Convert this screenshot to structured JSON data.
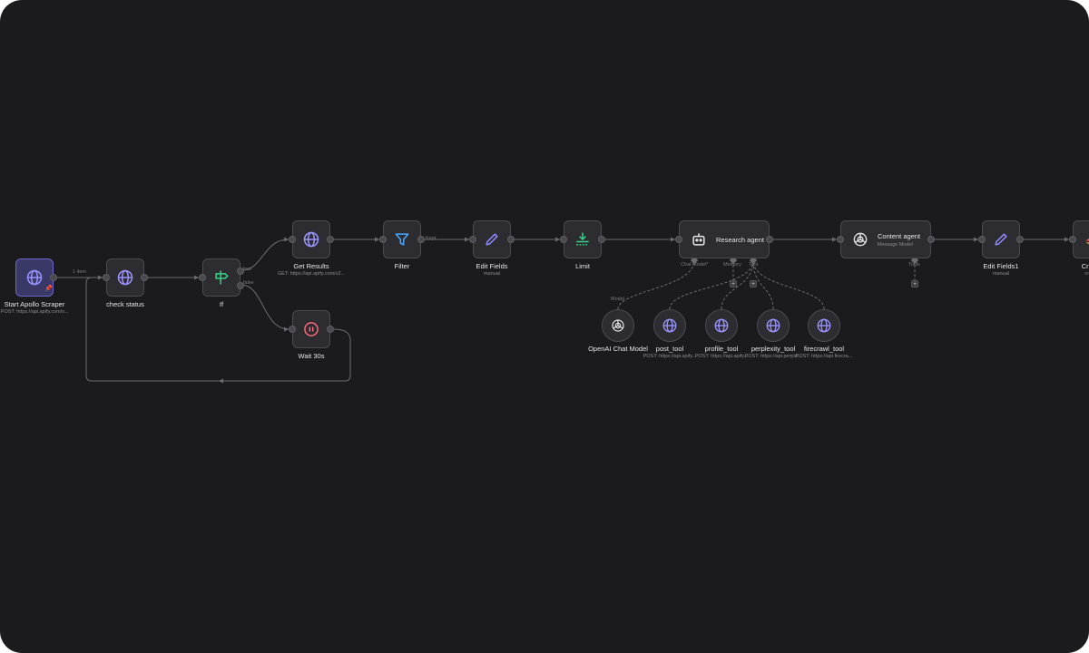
{
  "workflow": {
    "nodes": {
      "start_apollo_scraper": {
        "label": "Start Apollo Scraper",
        "sub": "POST: https://api.apify.com/v...",
        "icon": "globe-icon"
      },
      "check_status": {
        "label": "check status",
        "icon": "globe-icon"
      },
      "if": {
        "label": "If",
        "icon": "signpost-icon"
      },
      "get_results": {
        "label": "Get Results",
        "sub": "GET: https://api.apify.com/v2...",
        "icon": "globe-icon"
      },
      "filter": {
        "label": "Filter",
        "icon": "filter-icon"
      },
      "edit_fields": {
        "label": "Edit Fields",
        "sub": "manual",
        "icon": "pencil-icon"
      },
      "limit": {
        "label": "Limit",
        "icon": "limit-icon"
      },
      "research_agent": {
        "label": "Research agent",
        "icon": "robot-icon"
      },
      "content_agent": {
        "label": "Content agent",
        "sub": "Message Model",
        "icon": "openai-icon"
      },
      "edit_fields1": {
        "label": "Edit Fields1",
        "sub": "manual",
        "icon": "pencil-icon"
      },
      "create": {
        "label": "Create",
        "sub": "create",
        "icon": "brand-icon"
      },
      "wait_30s": {
        "label": "Wait 30s",
        "icon": "pause-icon"
      },
      "openai_chat_model": {
        "label": "OpenAI Chat Model",
        "icon": "openai-icon"
      },
      "post_tool": {
        "label": "post_tool",
        "sub": "POST: https://api.apify...",
        "icon": "globe-icon"
      },
      "profile_tool": {
        "label": "profile_tool",
        "sub": "POST: https://api.apify...",
        "icon": "globe-icon"
      },
      "perplexity_tool": {
        "label": "perplexity_tool",
        "sub": "POST: https://api.perple...",
        "icon": "globe-icon"
      },
      "firecrawl_tool": {
        "label": "firecrawl_tool",
        "sub": "POST: https://api.firecra...",
        "icon": "globe-icon"
      }
    },
    "edge_labels": {
      "items": "1 item",
      "true": "true",
      "false": "false",
      "kept": "Kept",
      "chat_model": "Chat Model*",
      "memory": "Memory",
      "tool": "Tool",
      "tools": "Tools",
      "model": "Model"
    },
    "pin": "📌",
    "add_symbol": "+"
  },
  "colors": {
    "canvas": "#1b1a1d",
    "node": "#2d2c30",
    "edge": "#6c6b70",
    "globe": "#9a94ff",
    "if": "#35d48a",
    "filter": "#4aa8ff",
    "limit": "#35d48a",
    "wait": "#ff6b7a",
    "pencil": "#8f8bff"
  }
}
